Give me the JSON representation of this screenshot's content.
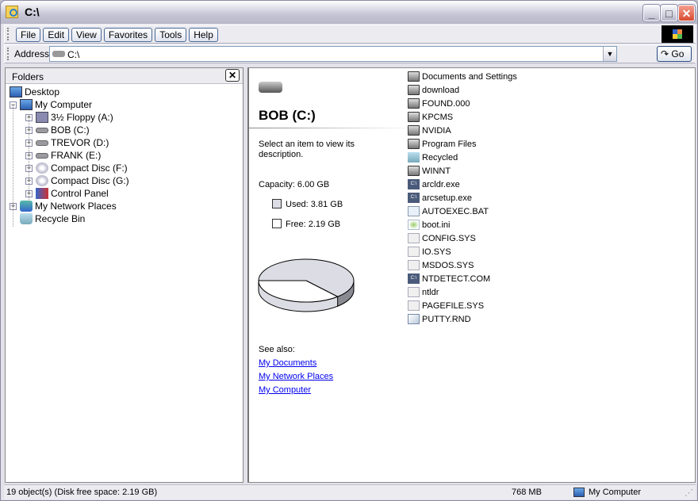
{
  "window": {
    "title": "C:\\",
    "minimize": "_",
    "maximize": "□",
    "close": "✕"
  },
  "menu": [
    {
      "label": "File"
    },
    {
      "label": "Edit"
    },
    {
      "label": "View"
    },
    {
      "label": "Favorites"
    },
    {
      "label": "Tools"
    },
    {
      "label": "Help"
    }
  ],
  "address": {
    "label": "Address",
    "value": "C:\\",
    "go": "Go"
  },
  "folders": {
    "title": "Folders",
    "close": "✕",
    "tree": [
      {
        "label": "Desktop",
        "icon": "desktop-icon",
        "level": 0,
        "expander": ""
      },
      {
        "label": "My Computer",
        "icon": "computer-icon",
        "level": 1,
        "expander": "−"
      },
      {
        "label": "3½ Floppy (A:)",
        "icon": "floppy-icon",
        "level": 2,
        "expander": "+"
      },
      {
        "label": "BOB (C:)",
        "icon": "drive-icon",
        "level": 2,
        "expander": "+"
      },
      {
        "label": "TREVOR (D:)",
        "icon": "drive-icon",
        "level": 2,
        "expander": "+"
      },
      {
        "label": "FRANK (E:)",
        "icon": "drive-icon",
        "level": 2,
        "expander": "+"
      },
      {
        "label": "Compact Disc (F:)",
        "icon": "cd-icon",
        "level": 2,
        "expander": "+"
      },
      {
        "label": "Compact Disc (G:)",
        "icon": "cd-icon",
        "level": 2,
        "expander": "+"
      },
      {
        "label": "Control Panel",
        "icon": "control-panel-icon",
        "level": 2,
        "expander": "+"
      },
      {
        "label": "My Network Places",
        "icon": "network-icon",
        "level": 1,
        "expander": "+"
      },
      {
        "label": "Recycle Bin",
        "icon": "recycle-bin-icon",
        "level": 1,
        "expander": ""
      }
    ]
  },
  "details": {
    "title": "BOB (C:)",
    "description": "Select an item to view its description.",
    "capacity": "Capacity: 6.00 GB",
    "used": "Used: 3.81 GB",
    "free": "Free: 2.19 GB",
    "used_gb": 3.81,
    "free_gb": 2.19,
    "used_color": "#dcdce4",
    "free_color": "#ffffff",
    "see_also": "See also:",
    "links": [
      {
        "label": "My Documents"
      },
      {
        "label": "My Network Places"
      },
      {
        "label": "My Computer"
      }
    ]
  },
  "files": [
    {
      "name": "Documents and Settings",
      "type": "folder"
    },
    {
      "name": "download",
      "type": "folder"
    },
    {
      "name": "FOUND.000",
      "type": "folder"
    },
    {
      "name": "KPCMS",
      "type": "folder"
    },
    {
      "name": "NVIDIA",
      "type": "folder"
    },
    {
      "name": "Program Files",
      "type": "folder"
    },
    {
      "name": "Recycled",
      "type": "bin"
    },
    {
      "name": "WINNT",
      "type": "folder"
    },
    {
      "name": "arcldr.exe",
      "type": "exe"
    },
    {
      "name": "arcsetup.exe",
      "type": "exe"
    },
    {
      "name": "AUTOEXEC.BAT",
      "type": "bat"
    },
    {
      "name": "boot.ini",
      "type": "ini"
    },
    {
      "name": "CONFIG.SYS",
      "type": "sys"
    },
    {
      "name": "IO.SYS",
      "type": "sys"
    },
    {
      "name": "MSDOS.SYS",
      "type": "sys"
    },
    {
      "name": "NTDETECT.COM",
      "type": "com"
    },
    {
      "name": "ntldr",
      "type": "sys"
    },
    {
      "name": "PAGEFILE.SYS",
      "type": "sys"
    },
    {
      "name": "PUTTY.RND",
      "type": "rnd"
    }
  ],
  "status": {
    "objects": "19 object(s) (Disk free space: 2.19 GB)",
    "size": "768 MB",
    "zone": "My Computer"
  }
}
